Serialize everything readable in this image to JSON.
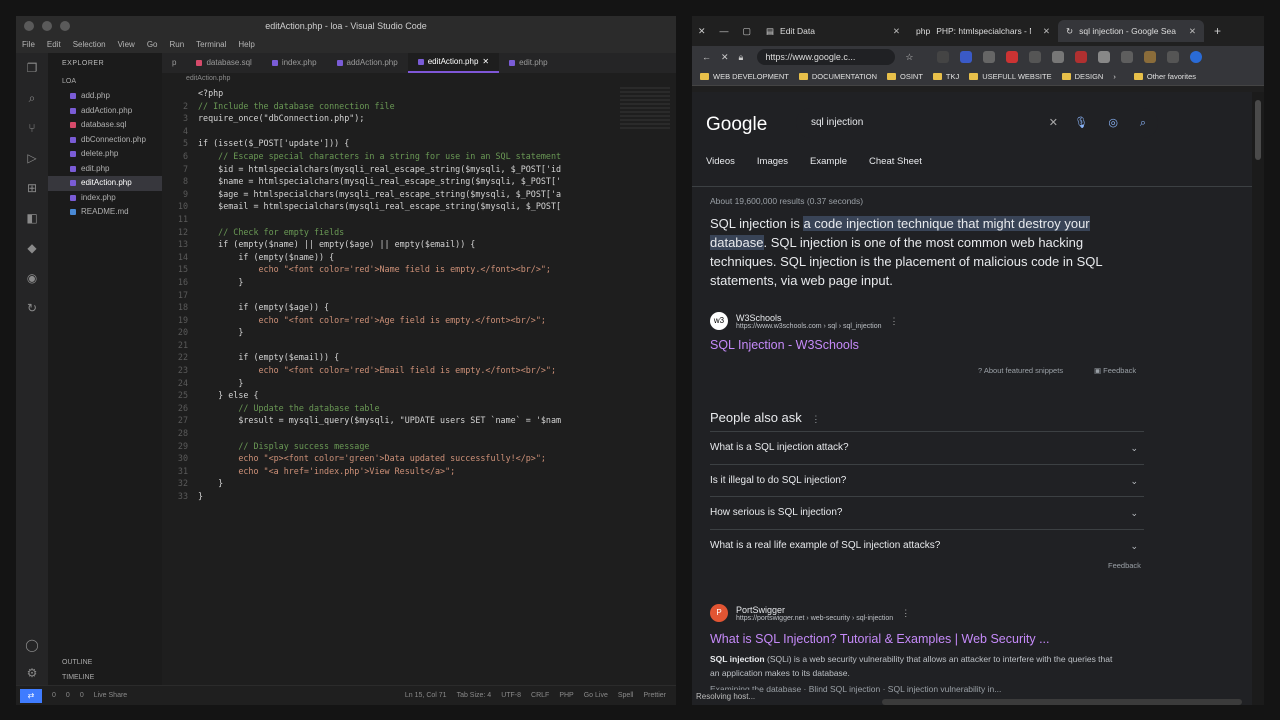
{
  "vscode": {
    "title": "editAction.php - loa - Visual Studio Code",
    "menu": [
      "File",
      "Edit",
      "Selection",
      "View",
      "Go",
      "Run",
      "Terminal",
      "Help"
    ],
    "explorer_label": "EXPLORER",
    "explorer_section": "LOA",
    "files": [
      "add.php",
      "addAction.php",
      "database.sql",
      "dbConnection.php",
      "delete.php",
      "edit.php",
      "editAction.php",
      "index.php",
      "README.md"
    ],
    "active_file": "editAction.php",
    "outline_label": "OUTLINE",
    "timeline_label": "TIMELINE",
    "tabs": [
      "p",
      "database.sql",
      "index.php",
      "addAction.php",
      "editAction.php",
      "edit.php"
    ],
    "breadcrumb": "editAction.php",
    "code_lines": [
      {
        "n": "",
        "t": "<?php"
      },
      {
        "n": "2",
        "t": "// Include the database connection file"
      },
      {
        "n": "3",
        "t": "require_once(\"dbConnection.php\");"
      },
      {
        "n": "4",
        "t": ""
      },
      {
        "n": "5",
        "t": "if (isset($_POST['update'])) {"
      },
      {
        "n": "6",
        "t": "    // Escape special characters in a string for use in an SQL statement"
      },
      {
        "n": "7",
        "t": "    $id = htmlspecialchars(mysqli_real_escape_string($mysqli, $_POST['id"
      },
      {
        "n": "8",
        "t": "    $name = htmlspecialchars(mysqli_real_escape_string($mysqli, $_POST['"
      },
      {
        "n": "9",
        "t": "    $age = htmlspecialchars(mysqli_real_escape_string($mysqli, $_POST['a"
      },
      {
        "n": "10",
        "t": "    $email = htmlspecialchars(mysqli_real_escape_string($mysqli, $_POST["
      },
      {
        "n": "11",
        "t": ""
      },
      {
        "n": "12",
        "t": "    // Check for empty fields"
      },
      {
        "n": "13",
        "t": "    if (empty($name) || empty($age) || empty($email)) {"
      },
      {
        "n": "14",
        "t": "        if (empty($name)) {"
      },
      {
        "n": "15",
        "t": "            echo \"<font color='red'>Name field is empty.</font><br/>\";"
      },
      {
        "n": "16",
        "t": "        }"
      },
      {
        "n": "17",
        "t": ""
      },
      {
        "n": "18",
        "t": "        if (empty($age)) {"
      },
      {
        "n": "19",
        "t": "            echo \"<font color='red'>Age field is empty.</font><br/>\";"
      },
      {
        "n": "20",
        "t": "        }"
      },
      {
        "n": "21",
        "t": ""
      },
      {
        "n": "22",
        "t": "        if (empty($email)) {"
      },
      {
        "n": "23",
        "t": "            echo \"<font color='red'>Email field is empty.</font><br/>\";"
      },
      {
        "n": "24",
        "t": "        }"
      },
      {
        "n": "25",
        "t": "    } else {"
      },
      {
        "n": "26",
        "t": "        // Update the database table"
      },
      {
        "n": "27",
        "t": "        $result = mysqli_query($mysqli, \"UPDATE users SET `name` = '$nam"
      },
      {
        "n": "28",
        "t": ""
      },
      {
        "n": "29",
        "t": "        // Display success message"
      },
      {
        "n": "30",
        "t": "        echo \"<p><font color='green'>Data updated successfully!</p>\";"
      },
      {
        "n": "31",
        "t": "        echo \"<a href='index.php'>View Result</a>\";"
      },
      {
        "n": "32",
        "t": "    }"
      },
      {
        "n": "33",
        "t": "}"
      }
    ],
    "status_left": [
      "0",
      "0",
      "0",
      "Live Share"
    ],
    "status_right": [
      "Ln 15, Col 71",
      "Tab Size: 4",
      "UTF-8",
      "CRLF",
      "PHP",
      "Go Live",
      "Spell",
      "Prettier"
    ]
  },
  "browser": {
    "tabs": [
      {
        "label": "Edit Data"
      },
      {
        "label": "PHP: htmlspecialchars - M"
      },
      {
        "label": "sql injection - Google Sea"
      }
    ],
    "url": "https://www.google.c...",
    "bookmarks": [
      "WEB DEVELOPMENT",
      "DOCUMENTATION",
      "OSINT",
      "TKJ",
      "USEFULL WEBSITE",
      "DESIGN"
    ],
    "other_bookmarks": "Other favorites",
    "google": {
      "logo": "Google",
      "query": "sql injection",
      "pills": [
        "Videos",
        "Images",
        "Example",
        "Cheat Sheet"
      ],
      "stats": "About 19,600,000 results (0.37 seconds)",
      "snippet_pre": "SQL injection is ",
      "snippet_hl": "a code injection technique that might destroy your database",
      "snippet_post": ". SQL injection is one of the most common web hacking techniques. SQL injection is the placement of malicious code in SQL statements, via web page input.",
      "source1": {
        "name": "W3Schools",
        "url": "https://www.w3schools.com › sql › sql_injection",
        "title": "SQL Injection - W3Schools"
      },
      "about_snippets": "About featured snippets",
      "feedback": "Feedback",
      "paa_title": "People also ask",
      "questions": [
        "What is a SQL injection attack?",
        "Is it illegal to do SQL injection?",
        "How serious is SQL injection?",
        "What is a real life example of SQL injection attacks?"
      ],
      "source2": {
        "name": "PortSwigger",
        "url": "https://portswigger.net › web-security › sql-injection",
        "title": "What is SQL Injection? Tutorial & Examples | Web Security ..."
      },
      "desc_bold": "SQL injection",
      "desc": " (SQLi) is a web security vulnerability that allows an attacker to interfere with the queries that an application makes to its database.",
      "desc2": "Examining the database · Blind SQL injection · SQL injection vulnerability in...",
      "status": "Resolving host..."
    }
  },
  "colors": {
    "accent": "#7f57d8",
    "link": "#c58af9",
    "highlight": "#394457"
  }
}
